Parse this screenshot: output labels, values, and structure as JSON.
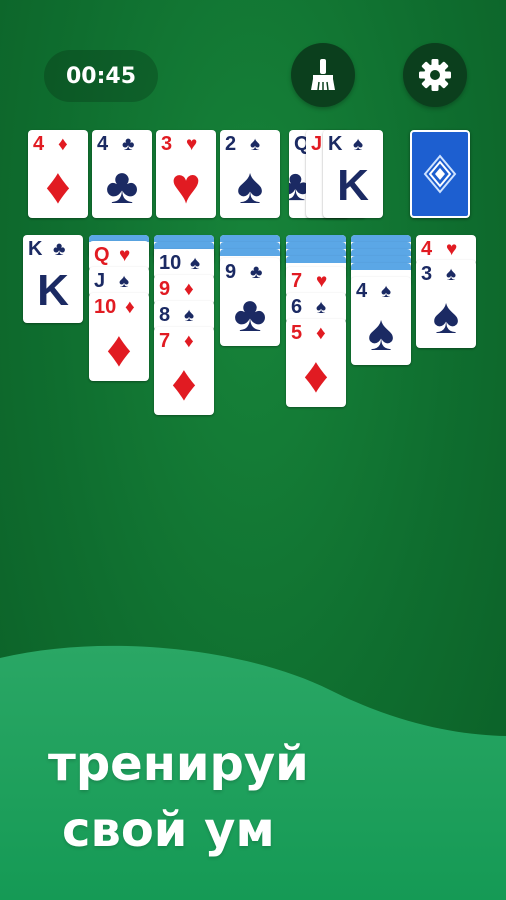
{
  "hud": {
    "timer": "00:45",
    "clean_icon": "broom-icon",
    "settings_icon": "gear-icon"
  },
  "foundations": [
    {
      "rank": "4",
      "suit": "♦",
      "color": "red"
    },
    {
      "rank": "4",
      "suit": "♣",
      "color": "navy"
    },
    {
      "rank": "3",
      "suit": "♥",
      "color": "red"
    },
    {
      "rank": "2",
      "suit": "♠",
      "color": "navy"
    }
  ],
  "waste": [
    {
      "rank": "Q",
      "suit": "♣",
      "color": "navy"
    },
    {
      "rank": "J",
      "suit": "♥",
      "color": "red"
    },
    {
      "rank": "K",
      "suit": "♠",
      "color": "navy",
      "face": "K"
    }
  ],
  "stock": {
    "icon": "card-back-diamond-icon"
  },
  "tableau": [
    {
      "facedown": 0,
      "cards": [
        {
          "rank": "K",
          "suit": "♣",
          "color": "navy",
          "face": "K"
        }
      ]
    },
    {
      "facedown": 1,
      "cards": [
        {
          "rank": "Q",
          "suit": "♥",
          "color": "red"
        },
        {
          "rank": "J",
          "suit": "♠",
          "color": "navy"
        },
        {
          "rank": "10",
          "suit": "♦",
          "color": "red"
        }
      ]
    },
    {
      "facedown": 2,
      "cards": [
        {
          "rank": "10",
          "suit": "♠",
          "color": "navy"
        },
        {
          "rank": "9",
          "suit": "♦",
          "color": "red"
        },
        {
          "rank": "8",
          "suit": "♠",
          "color": "navy"
        },
        {
          "rank": "7",
          "suit": "♦",
          "color": "red"
        }
      ]
    },
    {
      "facedown": 3,
      "cards": [
        {
          "rank": "9",
          "suit": "♣",
          "color": "navy"
        }
      ]
    },
    {
      "facedown": 4,
      "cards": [
        {
          "rank": "7",
          "suit": "♥",
          "color": "red"
        },
        {
          "rank": "6",
          "suit": "♠",
          "color": "navy"
        },
        {
          "rank": "5",
          "suit": "♦",
          "color": "red"
        }
      ]
    },
    {
      "facedown": 5,
      "cards": [
        {
          "rank": "4",
          "suit": "♠",
          "color": "navy"
        }
      ]
    },
    {
      "facedown": 0,
      "cards": [
        {
          "rank": "4",
          "suit": "♥",
          "color": "red"
        },
        {
          "rank": "3",
          "suit": "♠",
          "color": "navy"
        }
      ]
    }
  ],
  "slogan": {
    "line1": "тренируй",
    "line2": "свой ум"
  },
  "colors": {
    "felt": "#0f6e2f",
    "red_suit": "#e11b22",
    "black_suit": "#1b2a63",
    "card_back": "#1d5fd0",
    "facedown_stripe": "#5ba7e6",
    "button_bg": "#0b3f1d"
  }
}
